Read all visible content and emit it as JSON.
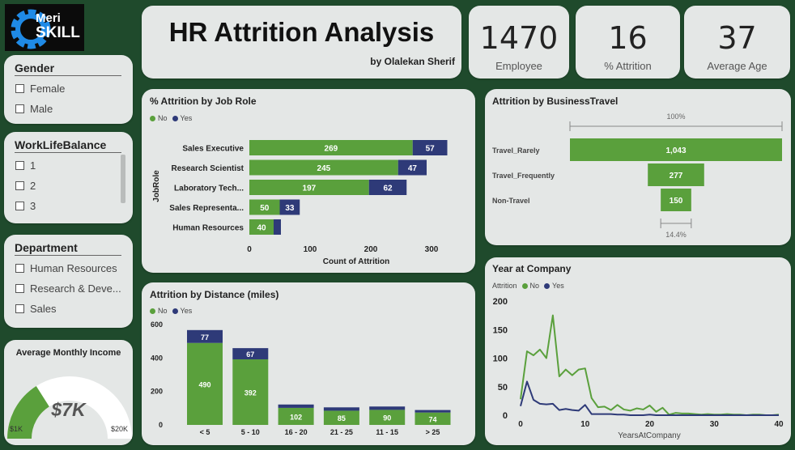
{
  "logo": {
    "line1": "Meri",
    "line2": "SKILL"
  },
  "header": {
    "title": "HR Attrition Analysis",
    "subtitle": "by Olalekan Sherif"
  },
  "kpis": [
    {
      "value": "1470",
      "label": "Employee"
    },
    {
      "value": "16",
      "label": "% Attrition"
    },
    {
      "value": "37",
      "label": "Average Age"
    }
  ],
  "slicers": {
    "gender": {
      "title": "Gender",
      "options": [
        "Female",
        "Male"
      ]
    },
    "worklife": {
      "title": "WorkLifeBalance",
      "options": [
        "1",
        "2",
        "3"
      ]
    },
    "department": {
      "title": "Department",
      "options": [
        "Human Resources",
        "Research & Deve...",
        "Sales"
      ]
    }
  },
  "gauge": {
    "title": "Average Monthly Income",
    "value": "$7K",
    "min": "$1K",
    "max": "$20K",
    "fraction": 0.32
  },
  "legend": {
    "no": "No",
    "yes": "Yes",
    "attrition": "Attrition"
  },
  "colors": {
    "no": "#5aa03c",
    "yes": "#2e3a78"
  },
  "chart_data": [
    {
      "type": "bar",
      "title": "% Attrition by Job Role",
      "orientation": "horizontal",
      "stacked": true,
      "categories": [
        "Sales Executive",
        "Research Scientist",
        "Laboratory Tech...",
        "Sales Representa...",
        "Human Resources"
      ],
      "series": [
        {
          "name": "No",
          "values": [
            269,
            245,
            197,
            50,
            40
          ]
        },
        {
          "name": "Yes",
          "values": [
            57,
            47,
            62,
            33,
            12
          ]
        }
      ],
      "xlabel": "Count of Attrition",
      "ylabel": "JobRole",
      "xticks": [
        "0",
        "100",
        "200",
        "300"
      ],
      "xlim": [
        0,
        320
      ],
      "data_labels": {
        "no": [
          "269",
          "245",
          "197",
          "50",
          "40"
        ],
        "yes": [
          "57",
          "47",
          "62",
          "33",
          ""
        ]
      }
    },
    {
      "type": "bar",
      "title": "Attrition by BusinessTravel",
      "orientation": "funnel",
      "categories": [
        "Travel_Rarely",
        "Travel_Frequently",
        "Non-Travel"
      ],
      "values": [
        1043,
        277,
        150
      ],
      "value_labels": [
        "1,043",
        "277",
        "150"
      ],
      "top_label": "100%",
      "bottom_label": "14.4%"
    },
    {
      "type": "bar",
      "title": "Attrition by Distance (miles)",
      "stacked": true,
      "categories": [
        "< 5",
        "5 - 10",
        "16 - 20",
        "21 - 25",
        "11 - 15",
        "> 25"
      ],
      "series": [
        {
          "name": "No",
          "values": [
            490,
            392,
            102,
            85,
            90,
            74
          ]
        },
        {
          "name": "Yes",
          "values": [
            77,
            67,
            20,
            20,
            20,
            15
          ]
        }
      ],
      "no_labels": [
        "490",
        "392",
        "102",
        "85",
        "90",
        "74"
      ],
      "yes_labels": [
        "77",
        "67",
        "",
        "",
        "",
        ""
      ],
      "yticks": [
        "0",
        "200",
        "400",
        "600"
      ],
      "ylim": [
        0,
        600
      ]
    },
    {
      "type": "line",
      "title": "Year at Company",
      "xlabel": "YearsAtCompany",
      "xticks": [
        "0",
        "10",
        "20",
        "30",
        "40"
      ],
      "yticks": [
        "0",
        "50",
        "100",
        "150",
        "200"
      ],
      "xlim": [
        0,
        40
      ],
      "ylim": [
        0,
        200
      ],
      "x": [
        0,
        1,
        2,
        3,
        4,
        5,
        6,
        7,
        8,
        9,
        10,
        11,
        12,
        13,
        14,
        15,
        16,
        17,
        18,
        19,
        20,
        21,
        22,
        23,
        24,
        25,
        26,
        27,
        28,
        29,
        30,
        31,
        32,
        33,
        34,
        35,
        36,
        37,
        38,
        39,
        40
      ],
      "series": [
        {
          "name": "No",
          "values": [
            28,
            112,
            105,
            115,
            100,
            175,
            68,
            80,
            70,
            80,
            82,
            30,
            14,
            15,
            9,
            18,
            10,
            8,
            12,
            10,
            17,
            6,
            13,
            1,
            4,
            3,
            3,
            2,
            1,
            2,
            1,
            1,
            2,
            1,
            1,
            0,
            1,
            1,
            0,
            0,
            1
          ]
        },
        {
          "name": "Yes",
          "values": [
            16,
            59,
            27,
            20,
            19,
            20,
            9,
            11,
            9,
            8,
            18,
            2,
            2,
            2,
            2,
            1,
            1,
            0,
            0,
            0,
            1,
            0,
            0,
            0,
            0,
            0,
            0,
            0,
            0,
            0,
            0,
            0,
            0,
            0,
            0,
            0,
            0,
            0,
            0,
            0,
            0
          ]
        }
      ]
    }
  ]
}
